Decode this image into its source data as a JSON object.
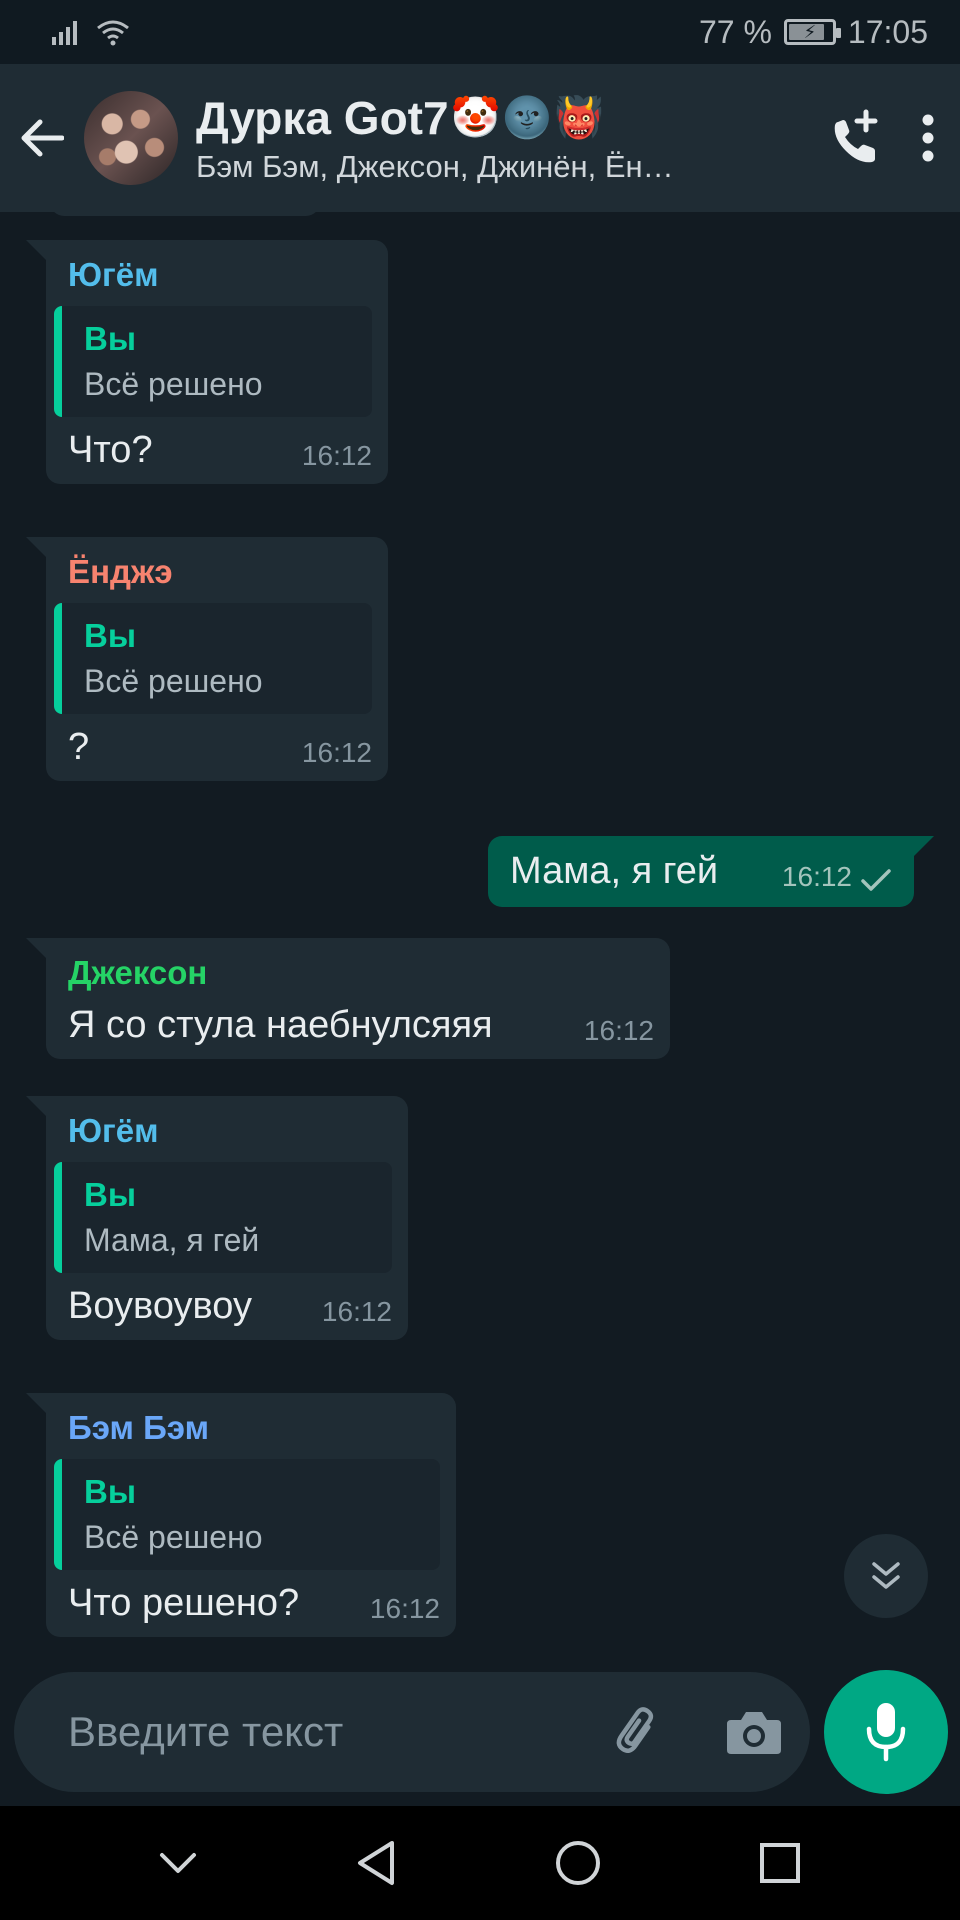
{
  "status_bar": {
    "battery": "77 %",
    "time": "17:05"
  },
  "header": {
    "title": "Дурка Got7",
    "title_emojis": [
      "🤡",
      "🌚",
      "👹"
    ],
    "subtitle": "Бэм Бэм, Джексон, Джинён, Ён…"
  },
  "colors": {
    "yugyeom": "#53bdeb",
    "youngjae": "#f7836f",
    "jackson": "#25d366",
    "bambam": "#6aa7f8",
    "quote_accent": "#06cf9c",
    "outgoing_bubble": "#005c4b"
  },
  "messages": [
    {
      "sender": "Югём",
      "quote_author": "Вы",
      "quote_text": "Всё решено",
      "text": "Что?",
      "time": "16:12"
    },
    {
      "sender": "Ёнджэ",
      "quote_author": "Вы",
      "quote_text": "Всё решено",
      "text": "?",
      "time": "16:12"
    },
    {
      "text": "Мама, я гей",
      "time": "16:12"
    },
    {
      "sender": "Джексон",
      "text": "Я со стула наебнулсяяя",
      "time": "16:12"
    },
    {
      "sender": "Югём",
      "quote_author": "Вы",
      "quote_text": "Мама, я гей",
      "text": "Воувоувоу",
      "time": "16:12"
    },
    {
      "sender": "Бэм Бэм",
      "quote_author": "Вы",
      "quote_text": "Всё решено",
      "text": "Что решено?",
      "time": "16:12"
    }
  ],
  "input": {
    "placeholder": "Введите текст"
  }
}
